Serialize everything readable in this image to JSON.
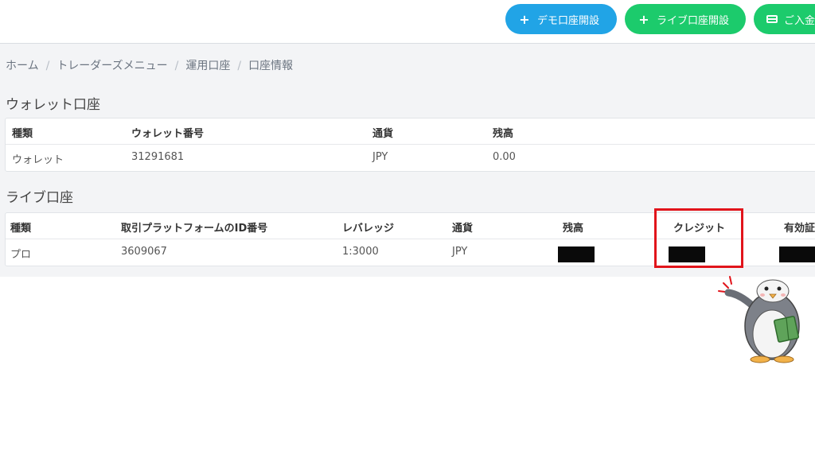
{
  "header": {
    "demo_button": "デモ口座開設",
    "live_button": "ライブ口座開設",
    "deposit_button": "ご入金",
    "plus_icon": "+"
  },
  "breadcrumb": {
    "items": [
      "ホーム",
      "トレーダーズメニュー",
      "運用口座",
      "口座情報"
    ],
    "separator": "/"
  },
  "wallet_section": {
    "title": "ウォレット口座",
    "columns": [
      "種類",
      "ウォレット番号",
      "通貨",
      "残高"
    ],
    "row": [
      "ウォレット",
      "31291681",
      "JPY",
      "0.00"
    ]
  },
  "live_section": {
    "title": "ライブ口座",
    "columns": [
      "種類",
      "取引プラットフォームのID番号",
      "レバレッジ",
      "通貨",
      "残高",
      "クレジット",
      "有効証"
    ],
    "row": [
      "プロ",
      "3609067",
      "1:3000",
      "JPY"
    ]
  },
  "colors": {
    "demo_button": "#21a4e6",
    "live_button": "#1ccb6c",
    "highlight_border": "#e1141b",
    "redaction": "#0a0a0a"
  },
  "icons": [
    "plus-icon",
    "credit-card-icon",
    "penguin-mascot"
  ]
}
